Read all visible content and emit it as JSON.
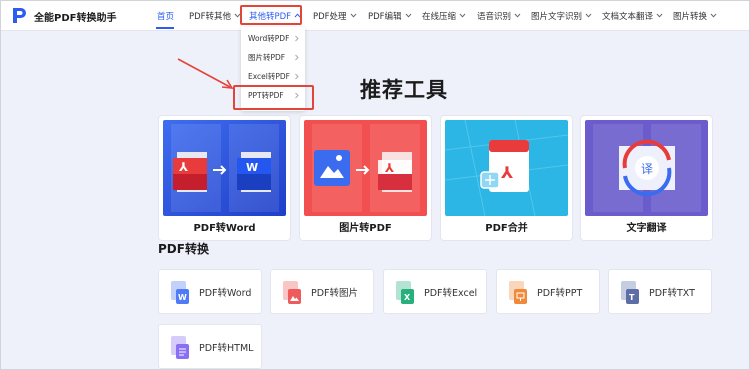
{
  "header": {
    "brand": "全能PDF转换助手",
    "nav": [
      {
        "label": "首页",
        "dropdown": false
      },
      {
        "label": "PDF转其他",
        "dropdown": true
      },
      {
        "label": "其他转PDF",
        "dropdown": true
      },
      {
        "label": "PDF处理",
        "dropdown": true
      },
      {
        "label": "PDF编辑",
        "dropdown": true
      },
      {
        "label": "在线压缩",
        "dropdown": true
      },
      {
        "label": "语音识别",
        "dropdown": true
      },
      {
        "label": "图片文字识别",
        "dropdown": true
      },
      {
        "label": "文档文本翻译",
        "dropdown": true
      },
      {
        "label": "图片转换",
        "dropdown": true
      }
    ]
  },
  "dropdown": {
    "items": [
      {
        "label": "Word转PDF"
      },
      {
        "label": "图片转PDF"
      },
      {
        "label": "Excel转PDF"
      },
      {
        "label": "PPT转PDF"
      }
    ]
  },
  "recommend": {
    "title": "推荐工具",
    "tools": [
      {
        "label": "PDF转Word"
      },
      {
        "label": "图片转PDF"
      },
      {
        "label": "PDF合并"
      },
      {
        "label": "文字翻译"
      }
    ]
  },
  "pdf_convert": {
    "title": "PDF转换",
    "tiles": [
      {
        "label": "PDF转Word",
        "icon_tag": "W",
        "color": "#4f7cf6"
      },
      {
        "label": "PDF转图片",
        "icon_tag": "",
        "color": "#ef5a5a"
      },
      {
        "label": "PDF转Excel",
        "icon_tag": "X",
        "color": "#27b07c"
      },
      {
        "label": "PDF转PPT",
        "icon_tag": "",
        "color": "#f08a3a"
      },
      {
        "label": "PDF转TXT",
        "icon_tag": "T",
        "color": "#5d6da8"
      },
      {
        "label": "PDF转HTML",
        "icon_tag": "",
        "color": "#8a6ef5"
      }
    ]
  },
  "colors": {
    "accent": "#2c5cf0",
    "highlight_box": "#e2453a",
    "page_bg": "#eef1fa"
  }
}
